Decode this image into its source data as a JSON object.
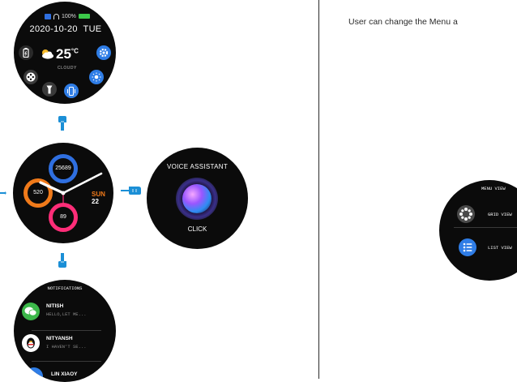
{
  "quick_panel": {
    "battery_percent": "100%",
    "date": "2020-10-20",
    "day": "TUE",
    "temperature": "25",
    "temp_unit": "°C",
    "weather": "CLOUDY",
    "colors": {
      "settings": "#2f7de6",
      "vibrate": "#2f7de6",
      "brightness": "#2f7de6"
    }
  },
  "analog": {
    "steps": "25689",
    "calories": "520",
    "heart_rate": "89",
    "day": "SUN",
    "date": "22",
    "colors": {
      "steps": "#2f6fe0",
      "calories": "#f07a1a",
      "heart": "#ff2d78"
    }
  },
  "voice": {
    "title": "VOICE ASSISTANT",
    "action": "CLICK"
  },
  "notifications": {
    "title": "NOTIFICATIONS",
    "items": [
      {
        "name": "NITISH",
        "message": "HELLO,LET ME...",
        "app": "wechat"
      },
      {
        "name": "NITYANSH",
        "message": "I HAVEN'T SE...",
        "app": "qq"
      },
      {
        "name": "LIN XIAOY",
        "message": "",
        "app": "other"
      }
    ]
  },
  "right": {
    "caption": "User can change the Menu a",
    "menu_title": "MENU VIEW",
    "options": [
      "GRID VIEW",
      "LIST VIEW"
    ]
  }
}
